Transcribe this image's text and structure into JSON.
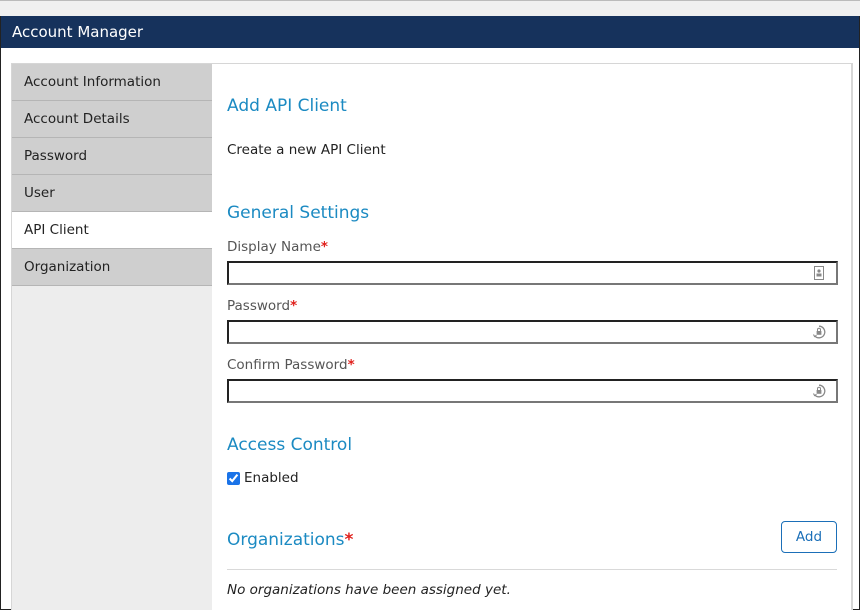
{
  "window": {
    "title": "Account Manager"
  },
  "sidebar": {
    "items": [
      {
        "label": "Account Information",
        "active": false
      },
      {
        "label": "Account Details",
        "active": false
      },
      {
        "label": "Password",
        "active": false
      },
      {
        "label": "User",
        "active": false
      },
      {
        "label": "API Client",
        "active": true
      },
      {
        "label": "Organization",
        "active": false
      }
    ]
  },
  "main": {
    "title": "Add API Client",
    "subtitle": "Create a new API Client",
    "general_settings": {
      "heading": "General Settings",
      "fields": [
        {
          "label": "Display Name",
          "required_mark": "*",
          "value": "",
          "placeholder": "",
          "icon": "contact-card-icon"
        },
        {
          "label": "Password",
          "required_mark": "*",
          "value": "",
          "placeholder": "",
          "icon": "lock-reset-icon"
        },
        {
          "label": "Confirm Password",
          "required_mark": "*",
          "value": "",
          "placeholder": "",
          "icon": "lock-reset-icon"
        }
      ]
    },
    "access_control": {
      "heading": "Access Control",
      "enabled_label": "Enabled",
      "enabled_checked": true
    },
    "organizations": {
      "heading": "Organizations",
      "required_mark": "*",
      "add_label": "Add",
      "empty_text": "No organizations have been assigned yet."
    }
  },
  "colors": {
    "titlebar": "#16325c",
    "heading": "#1b8ac2",
    "required": "#e0201c",
    "button": "#1b6fb8"
  }
}
